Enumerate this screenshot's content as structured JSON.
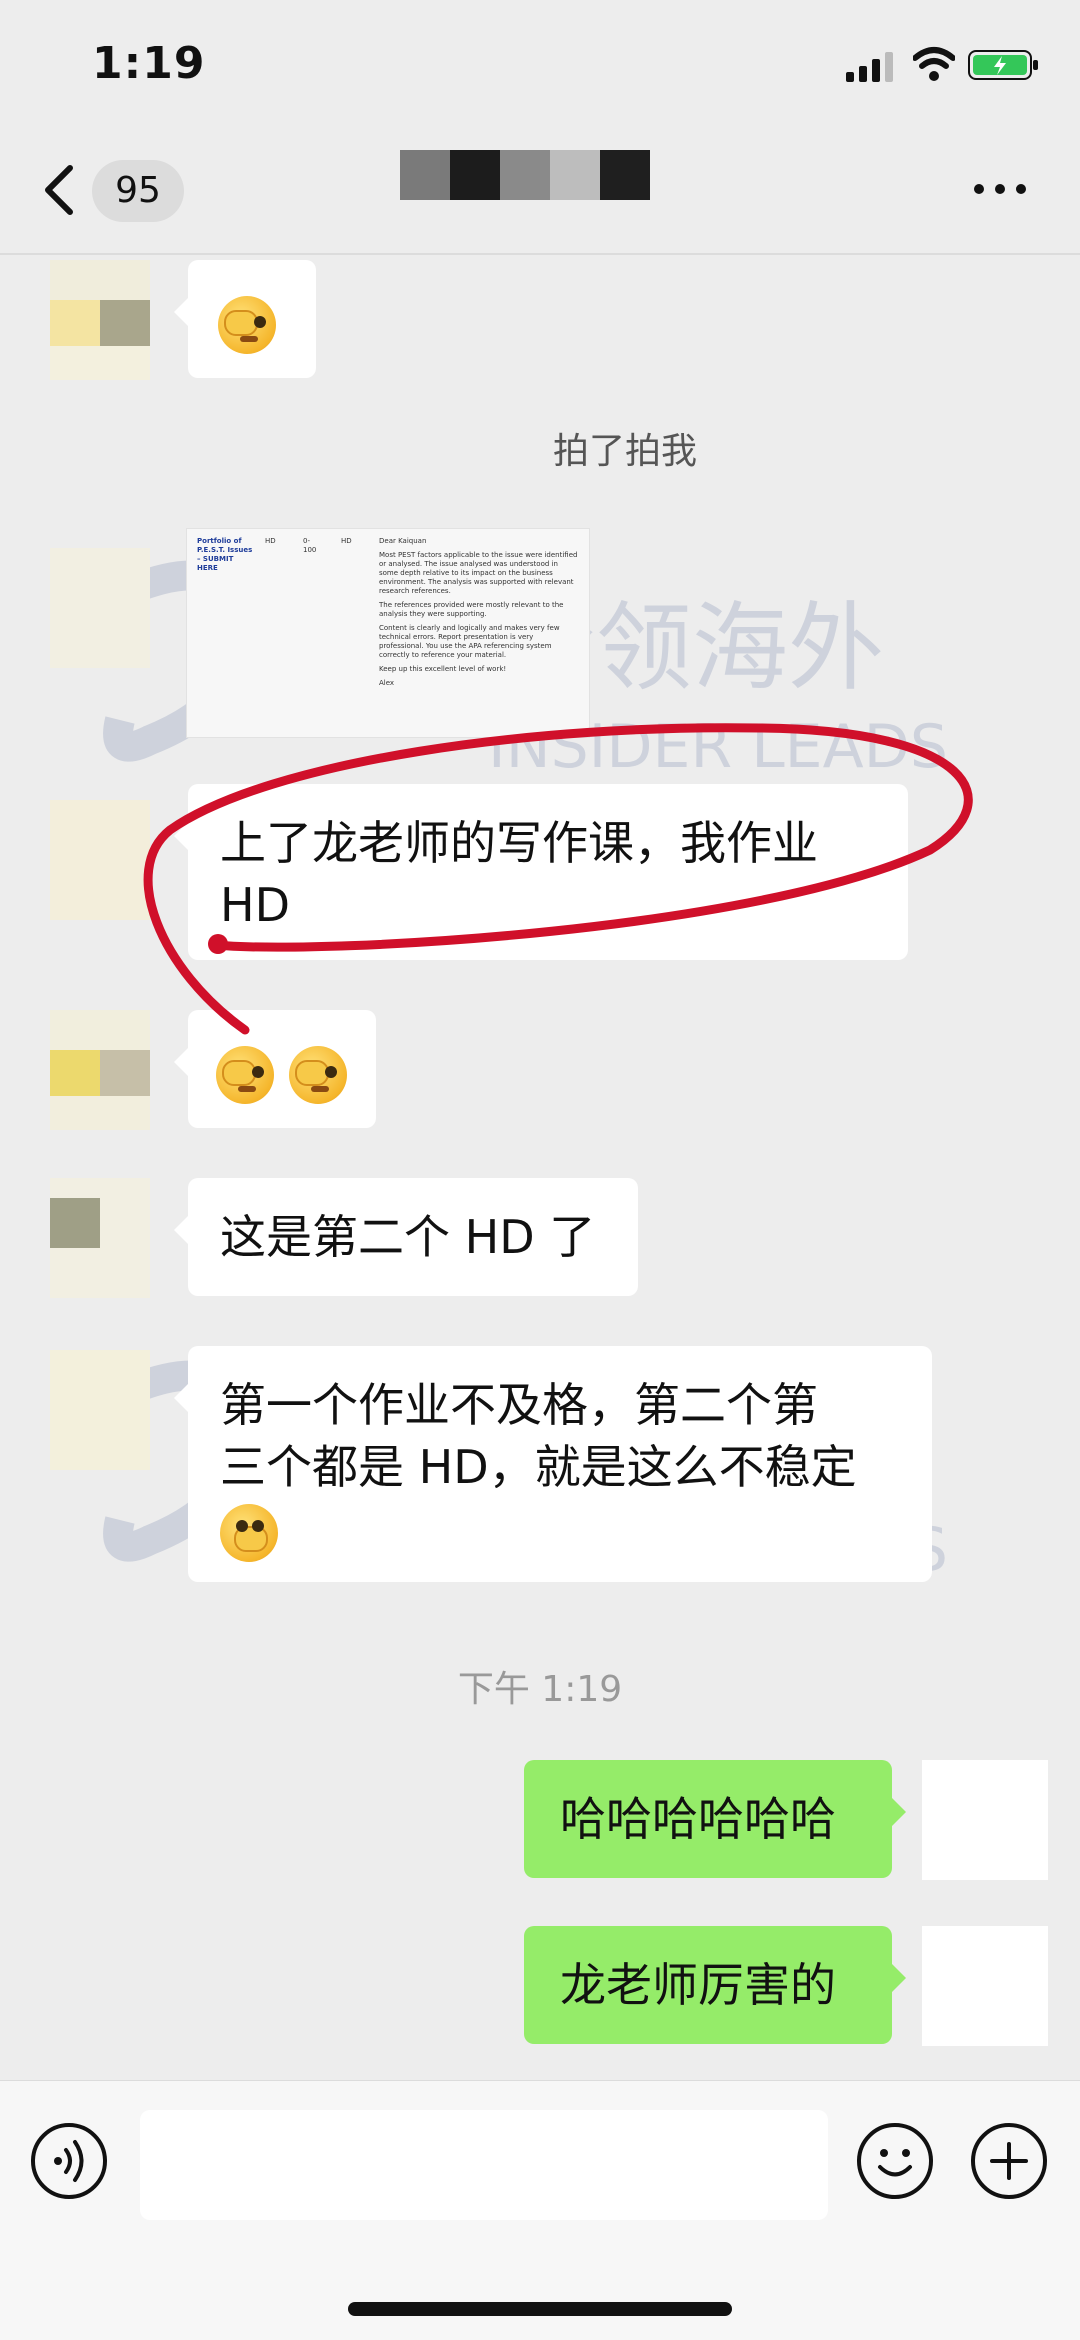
{
  "status_bar": {
    "time": "1:19",
    "icons": [
      "signal-icon",
      "wifi-icon",
      "battery-charging-icon"
    ]
  },
  "nav": {
    "back_icon": "chevron-left-icon",
    "unread_count": "95",
    "title_obscured": true,
    "more_icon": "more-dots-icon"
  },
  "messages": [
    {
      "side": "in",
      "type": "emoji",
      "emoji": "facepalm-peek-emoji"
    },
    {
      "type": "system",
      "text": "拍了拍我"
    },
    {
      "side": "in",
      "type": "image",
      "screenshot": {
        "col1": [
          "Portfolio of",
          "P.E.S.T. Issues",
          "– SUBMIT",
          "HERE"
        ],
        "col2": "HD",
        "col3": [
          "0-",
          "100"
        ],
        "col4": "HD",
        "greeting": "Dear Kaiquan",
        "p1": "Most PEST factors applicable to the issue were identified or analysed. The issue analysed was understood in some depth relative to its impact on the business environment. The analysis was supported with relevant research references.",
        "p2": "The references provided were mostly relevant to the analysis they were supporting.",
        "p3": "Content is clearly and logically and makes very few technical errors. Report presentation is very professional. You use the APA referencing system correctly to reference your material.",
        "p4": "Keep up this excellent level of work!",
        "sign": "Alex"
      }
    },
    {
      "side": "in",
      "type": "text",
      "text_line1": "上了龙老师的写作课，我作业",
      "text_line2": "HD"
    },
    {
      "side": "in",
      "type": "emoji",
      "emoji": "facepalm-peek-emoji-x2"
    },
    {
      "side": "in",
      "type": "text",
      "text": "这是第二个 HD 了"
    },
    {
      "side": "in",
      "type": "text",
      "text_line1": "第一个作业不及格，第二个第",
      "text_line2": "三个都是 HD，就是这么不稳定",
      "emoji": "facepalm-laugh-emoji"
    },
    {
      "type": "time",
      "text": "下午 1:19"
    },
    {
      "side": "out",
      "type": "text",
      "text": "哈哈哈哈哈哈"
    },
    {
      "side": "out",
      "type": "text",
      "text": "龙老师厉害的"
    }
  ],
  "watermark": {
    "cn": "吟领海外",
    "en": "INSIDER LEADS"
  },
  "input_bar": {
    "voice_icon": "voice-icon",
    "emoji_icon": "emoji-icon",
    "plus_icon": "plus-circle-icon",
    "input_value": ""
  },
  "colors": {
    "background": "#ededed",
    "bubble_out": "#95ec69",
    "bubble_in": "#ffffff",
    "annotation": "#d0102a"
  }
}
